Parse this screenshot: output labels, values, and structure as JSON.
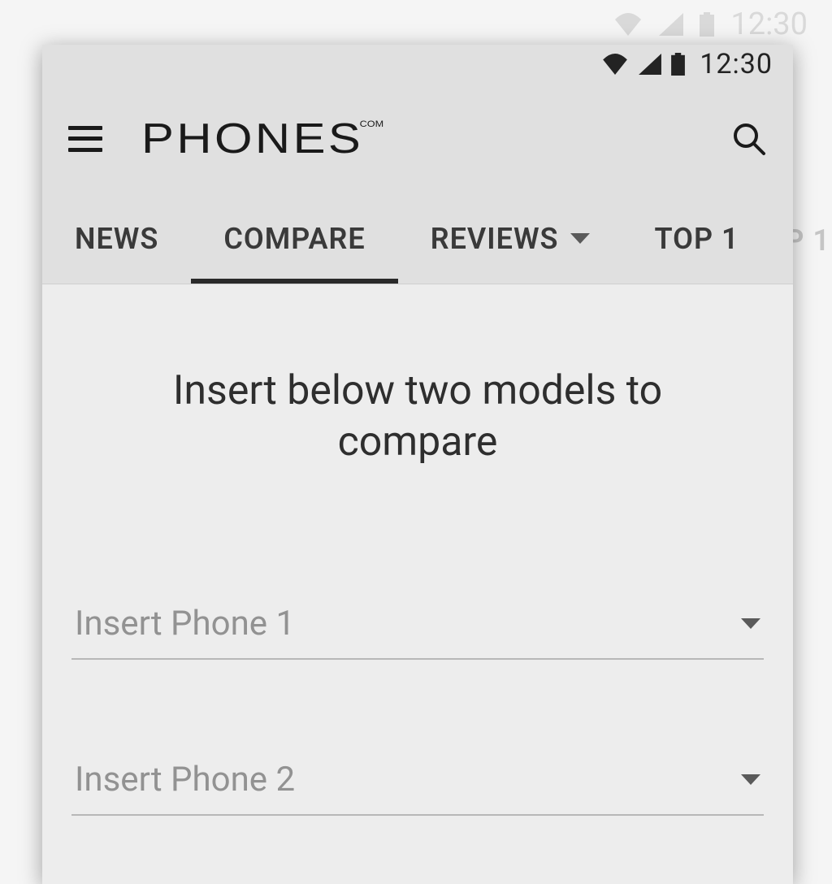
{
  "ghost_status": {
    "time": "12:30"
  },
  "status_bar": {
    "time": "12:30"
  },
  "app_bar": {
    "title_main": "PHONES",
    "title_suffix": "COM"
  },
  "tabs": [
    {
      "label": "NEWS",
      "active": false,
      "has_dropdown": false
    },
    {
      "label": "COMPARE",
      "active": true,
      "has_dropdown": false
    },
    {
      "label": "REVIEWS",
      "active": false,
      "has_dropdown": true
    },
    {
      "label": "TOP 1",
      "active": false,
      "has_dropdown": false
    }
  ],
  "content": {
    "heading": "Insert below two models to compare",
    "phone_selects": [
      {
        "placeholder": "Insert Phone 1"
      },
      {
        "placeholder": "Insert Phone 2"
      }
    ]
  },
  "ghost_tab": "P 1"
}
